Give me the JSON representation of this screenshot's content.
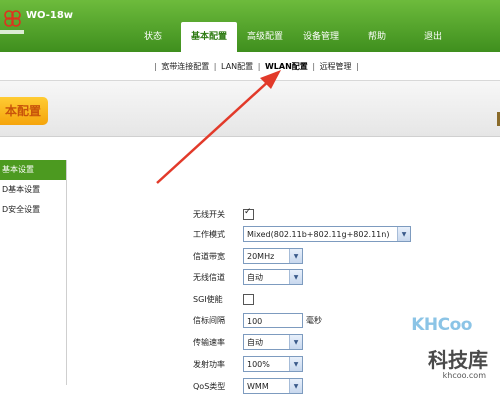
{
  "header": {
    "model": "WO-18w",
    "nav": [
      {
        "label": "状态",
        "active": false
      },
      {
        "label": "基本配置",
        "active": true
      },
      {
        "label": "高级配置",
        "active": false
      },
      {
        "label": "设备管理",
        "active": false
      },
      {
        "label": "帮助",
        "active": false
      },
      {
        "label": "退出",
        "active": false
      }
    ],
    "accent": "#4c9a20"
  },
  "subnav": {
    "items": [
      "宽带连接配置",
      "LAN配置",
      "WLAN配置",
      "远程管理"
    ],
    "active": "WLAN配置",
    "separator": "|"
  },
  "page_title": "本配置",
  "sidebar": {
    "items": [
      {
        "label": "基本设置",
        "active": true
      },
      {
        "label": "D基本设置",
        "active": false
      },
      {
        "label": "D安全设置",
        "active": false
      }
    ]
  },
  "form": {
    "wireless_switch": {
      "label": "无线开关",
      "checked": true
    },
    "work_mode": {
      "label": "工作模式",
      "value": "Mixed(802.11b+802.11g+802.11n)"
    },
    "channel_bandwidth": {
      "label": "信道带宽",
      "value": "20MHz"
    },
    "wireless_channel": {
      "label": "无线信道",
      "value": "自动"
    },
    "sgi": {
      "label": "SGI使能",
      "checked": false
    },
    "beacon_interval": {
      "label": "信标间隔",
      "value": "100",
      "unit": "毫秒"
    },
    "tx_rate": {
      "label": "传输速率",
      "value": "自动"
    },
    "tx_power": {
      "label": "发射功率",
      "value": "100%"
    },
    "qos": {
      "label": "QoS类型",
      "value": "WMM"
    }
  },
  "watermark": {
    "brand": "KHCoo",
    "cn": "科技库",
    "url": "khcoo.com"
  },
  "annotation_color": "#e23a2a"
}
